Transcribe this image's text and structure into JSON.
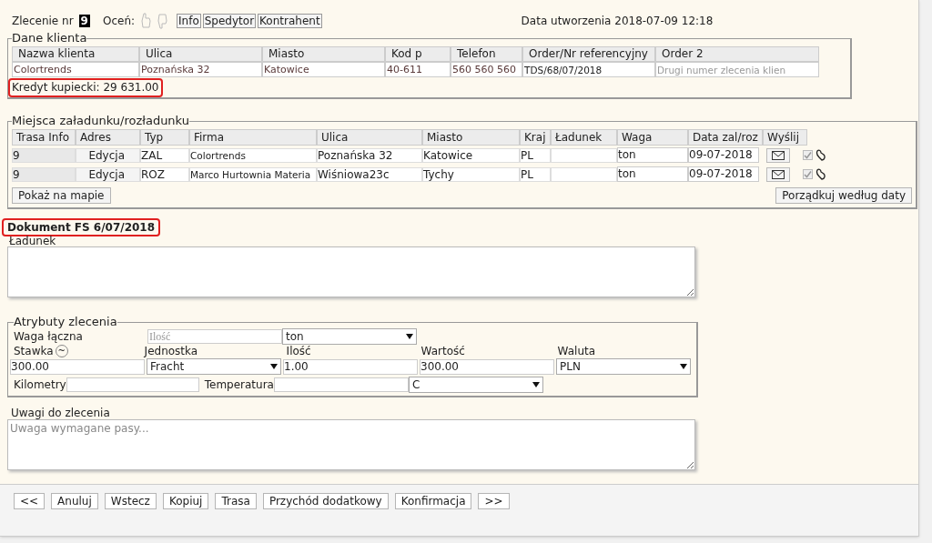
{
  "header": {
    "order_label": "Zlecenie nr",
    "order_number": "9",
    "rate_label": "Oceń:",
    "buttons": [
      "Info",
      "Spedytor",
      "Kontrahent"
    ],
    "created": "Data utworzenia 2018-07-09 12:18"
  },
  "client": {
    "legend": "Dane klienta",
    "columns": [
      "Nazwa klienta",
      "Ulica",
      "Miasto",
      "Kod p",
      "Telefon",
      "Order/Nr referencyjny",
      "Order 2"
    ],
    "row": [
      {
        "value": "Colortrends",
        "kind": "text"
      },
      {
        "value": "Poznańska 32",
        "kind": "text"
      },
      {
        "value": "Katowice",
        "kind": "text"
      },
      {
        "value": "40-611",
        "kind": "text"
      },
      {
        "value": "560 560 560",
        "kind": "text"
      },
      {
        "value": "TDS/68/07/2018",
        "kind": "input"
      },
      {
        "placeholder": "Drugi numer zlecenia klien",
        "kind": "input"
      }
    ],
    "credit": {
      "text": "Kredyt kupiecki: 29 631.00",
      "highlighted": true
    }
  },
  "stops": {
    "legend": "Miejsca załadunku/rozładunku",
    "columns": [
      "Trasa Info",
      "Adres",
      "Typ",
      "Firma",
      "Ulica",
      "Miasto",
      "Kraj",
      "Ładunek",
      "Waga",
      "Data zal/roz",
      "Wyślij"
    ],
    "rows": [
      {
        "trasa": "9",
        "adres": "Edycja",
        "typ": "ZAL",
        "firma": "Colortrends",
        "ulica": "Poznańska 32",
        "miasto": "Katowice",
        "kraj": "PL",
        "waga": "ton",
        "data": "09-07-2018",
        "checked": true
      },
      {
        "trasa": "9",
        "adres": "Edycja",
        "typ": "ROZ",
        "firma": "Marco Hurtownia Materia",
        "ulica": "Wiśniowa23c",
        "miasto": "Tychy",
        "kraj": "PL",
        "waga": "ton",
        "data": "09-07-2018",
        "checked": true
      }
    ],
    "map_button": "Pokaż na mapie",
    "sort_button": "Porządkuj według daty"
  },
  "document": {
    "text": "Dokument FS 6/07/2018",
    "highlighted": true
  },
  "cargo": {
    "label": "Ładunek"
  },
  "attributes": {
    "legend": "Atrybuty zlecenia",
    "total_weight_label": "Waga łączna",
    "qty_placeholder": "Ilość",
    "unit": "ton",
    "rate_label": "Stawka",
    "rate_button": "~",
    "unit_label": "Jednostka",
    "qty_label": "Ilość",
    "value_label": "Wartość",
    "currency_label": "Waluta",
    "rate": "300.00",
    "unit_value": "Fracht",
    "qty": "1.00",
    "value": "300.00",
    "currency": "PLN",
    "km_label": "Kilometry",
    "temp_label": "Temperatura",
    "temp_unit": "C"
  },
  "notes": {
    "label": "Uwagi do zlecenia",
    "placeholder": "Uwaga wymagane pasy..."
  },
  "footer": [
    "<<",
    "Anuluj",
    "Wstecz",
    "Kopiuj",
    "Trasa",
    "Przychód dodatkowy",
    "Konfirmacja",
    ">>"
  ]
}
